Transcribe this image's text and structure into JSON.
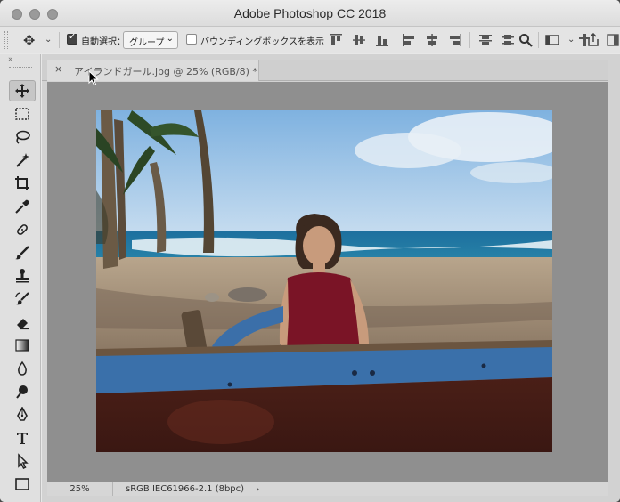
{
  "window": {
    "title": "Adobe Photoshop CC 2018"
  },
  "options_bar": {
    "auto_select_label": "自動選択：",
    "auto_select_checked": true,
    "auto_select_target": "グループ",
    "transform_controls_label": "バウンディングボックスを表示",
    "transform_controls_checked": false
  },
  "document": {
    "tab_close": "×",
    "tab_title": "アイランドガール.jpg @ 25% (RGB/8) *"
  },
  "status": {
    "zoom": "25%",
    "profile": "sRGB IEC61966-2.1 (8bpc)",
    "arrow": "›"
  },
  "tools": [
    "move-tool",
    "marquee-tool",
    "lasso-tool",
    "magic-wand-tool",
    "crop-tool",
    "eyedropper-tool",
    "healing-brush-tool",
    "brush-tool",
    "clone-stamp-tool",
    "history-brush-tool",
    "eraser-tool",
    "gradient-tool",
    "blur-tool",
    "dodge-tool",
    "pen-tool",
    "type-tool",
    "path-selection-tool",
    "rectangle-tool"
  ],
  "colors": {
    "accent": "#3a3a3a",
    "canvas_bg": "#8f8f8f"
  }
}
